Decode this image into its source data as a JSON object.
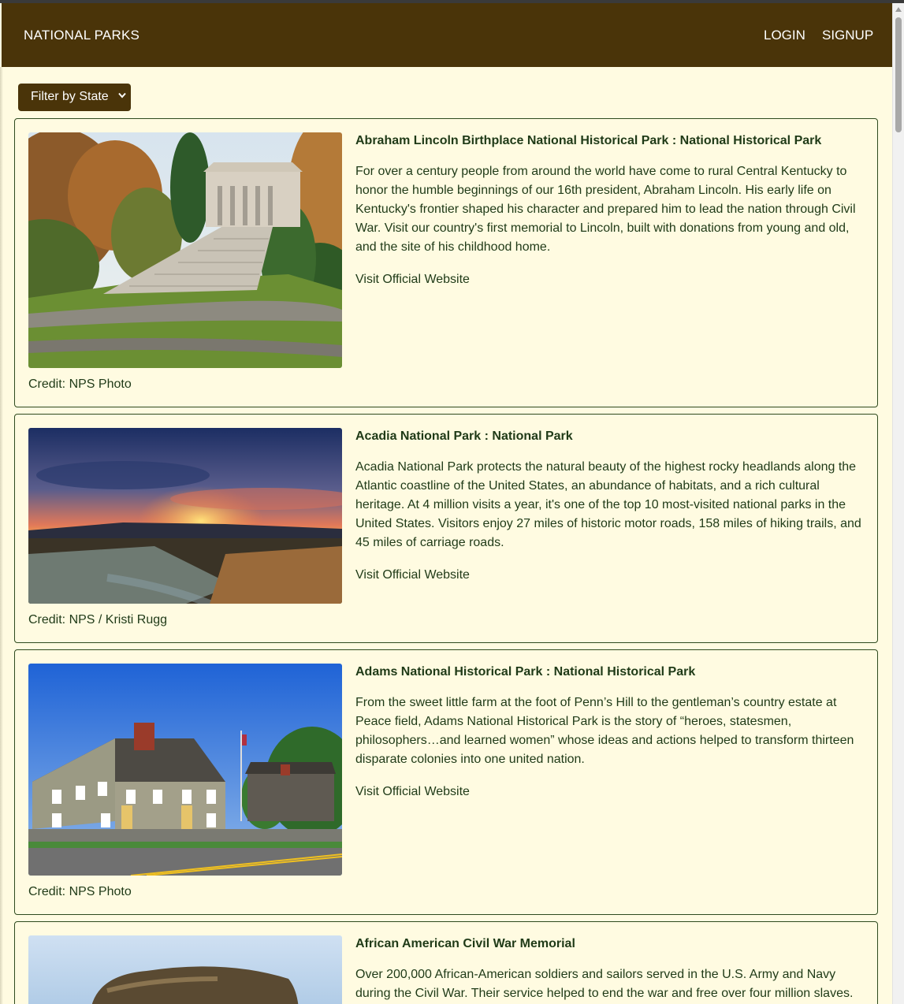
{
  "navbar": {
    "brand": "NATIONAL PARKS",
    "login": "LOGIN",
    "signup": "SIGNUP"
  },
  "filter": {
    "label": "Filter by State"
  },
  "parks": [
    {
      "title": "Abraham Lincoln Birthplace National Historical Park : National Historical Park",
      "description": "For over a century people from around the world have come to rural Central Kentucky to honor the humble beginnings of our 16th president, Abraham Lincoln. His early life on Kentucky's frontier shaped his character and prepared him to lead the nation through Civil War. Visit our country's first memorial to Lincoln, built with donations from young and old, and the site of his childhood home.",
      "link": "Visit Official Website",
      "credit": "Credit: NPS Photo"
    },
    {
      "title": "Acadia National Park : National Park",
      "description": "Acadia National Park protects the natural beauty of the highest rocky headlands along the Atlantic coastline of the United States, an abundance of habitats, and a rich cultural heritage. At 4 million visits a year, it's one of the top 10 most-visited national parks in the United States. Visitors enjoy 27 miles of historic motor roads, 158 miles of hiking trails, and 45 miles of carriage roads.",
      "link": "Visit Official Website",
      "credit": "Credit: NPS / Kristi Rugg"
    },
    {
      "title": "Adams National Historical Park : National Historical Park",
      "description": "From the sweet little farm at the foot of Penn’s Hill to the gentleman’s country estate at Peace field, Adams National Historical Park is the story of “heroes, statesmen, philosophers…and learned women” whose ideas and actions helped to transform thirteen disparate colonies into one united nation.",
      "link": "Visit Official Website",
      "credit": "Credit: NPS Photo"
    },
    {
      "title": "African American Civil War Memorial",
      "description": "Over 200,000 African-American soldiers and sailors served in the U.S. Army and Navy during the Civil War. Their service helped to end the war and free over four million slaves."
    }
  ]
}
